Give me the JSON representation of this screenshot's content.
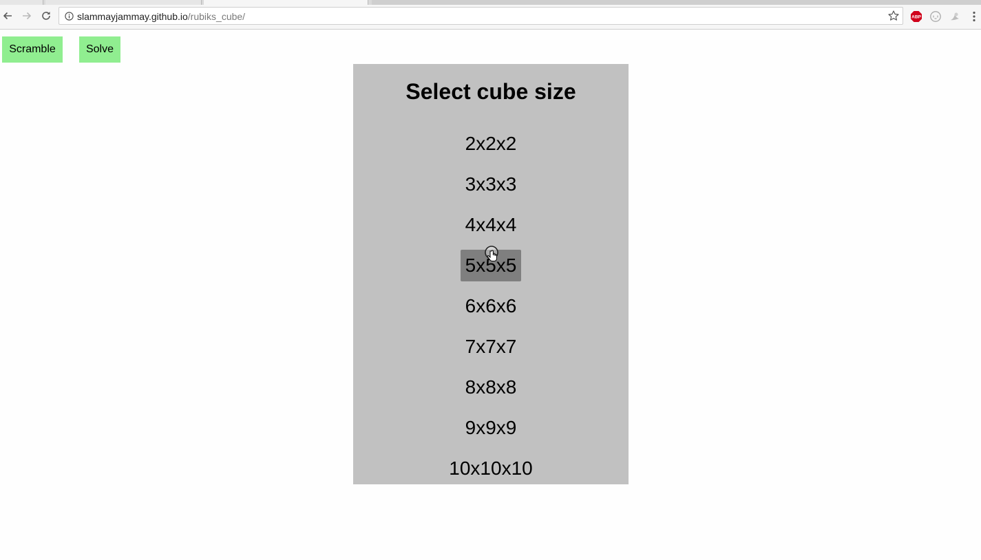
{
  "browser": {
    "url_host": "slammayjammay.github.io",
    "url_path": "/rubiks_cube/",
    "icons": {
      "back": "back-arrow-icon",
      "forward": "forward-arrow-icon",
      "reload": "reload-icon",
      "info": "info-icon",
      "bookmark": "star-icon",
      "adblock": "adblock-icon",
      "extension2": "extension-icon",
      "extension3": "extension-icon",
      "menu": "menu-dots-icon"
    },
    "adblock_label": "ABP"
  },
  "controls": {
    "scramble_label": "Scramble",
    "solve_label": "Solve",
    "button_color": "#90ee90"
  },
  "menu": {
    "title": "Select cube size",
    "background": "#c1c1c1",
    "hover_color": "#7f7f7f",
    "hovered_index": 3,
    "sizes": [
      "2x2x2",
      "3x3x3",
      "4x4x4",
      "5x5x5",
      "6x6x6",
      "7x7x7",
      "8x8x8",
      "9x9x9",
      "10x10x10"
    ]
  }
}
